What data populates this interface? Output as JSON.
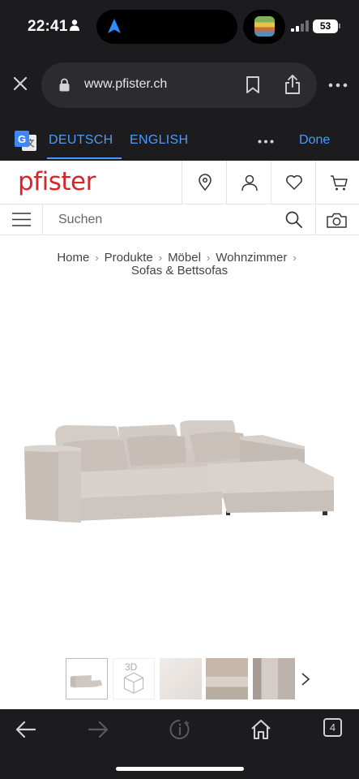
{
  "status_bar": {
    "time": "22:41",
    "battery_percent": "53"
  },
  "browser": {
    "url": "www.pfister.ch"
  },
  "translate_bar": {
    "lang_selected": "DEUTSCH",
    "lang_other": "ENGLISH",
    "done_label": "Done"
  },
  "site": {
    "logo": "pfister",
    "search_placeholder": "Suchen",
    "breadcrumb": [
      "Home",
      "Produkte",
      "Möbel",
      "Wohnzimmer",
      "Sofas & Bettsofas"
    ],
    "thumbnail_3d_label": "3D"
  },
  "toolbar": {
    "tabs_count": "4"
  },
  "colors": {
    "brand": "#d7262b",
    "link_blue": "#4a9bff",
    "chrome_dark": "#1c1c1e"
  }
}
